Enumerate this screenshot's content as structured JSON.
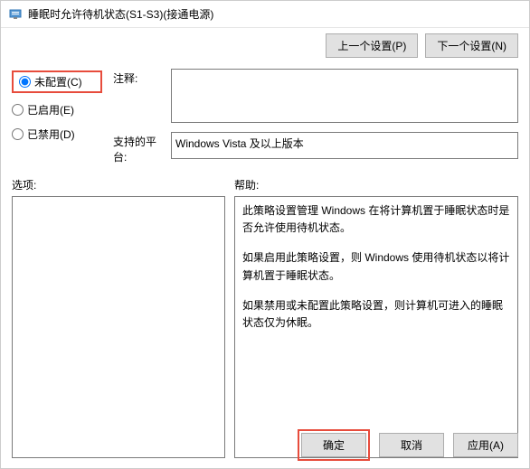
{
  "window": {
    "title": "睡眠时允许待机状态(S1-S3)(接通电源)"
  },
  "nav": {
    "prev": "上一个设置(P)",
    "next": "下一个设置(N)"
  },
  "radios": {
    "not_configured": "未配置(C)",
    "enabled": "已启用(E)",
    "disabled": "已禁用(D)"
  },
  "fields": {
    "comment_label": "注释:",
    "comment_value": "",
    "platform_label": "支持的平台:",
    "platform_value": "Windows Vista 及以上版本"
  },
  "section_labels": {
    "options": "选项:",
    "help": "帮助:"
  },
  "help": {
    "p1": "此策略设置管理 Windows 在将计算机置于睡眠状态时是否允许使用待机状态。",
    "p2": "如果启用此策略设置，则 Windows 使用待机状态以将计算机置于睡眠状态。",
    "p3": "如果禁用或未配置此策略设置，则计算机可进入的睡眠状态仅为休眠。"
  },
  "buttons": {
    "ok": "确定",
    "cancel": "取消",
    "apply": "应用(A)"
  }
}
